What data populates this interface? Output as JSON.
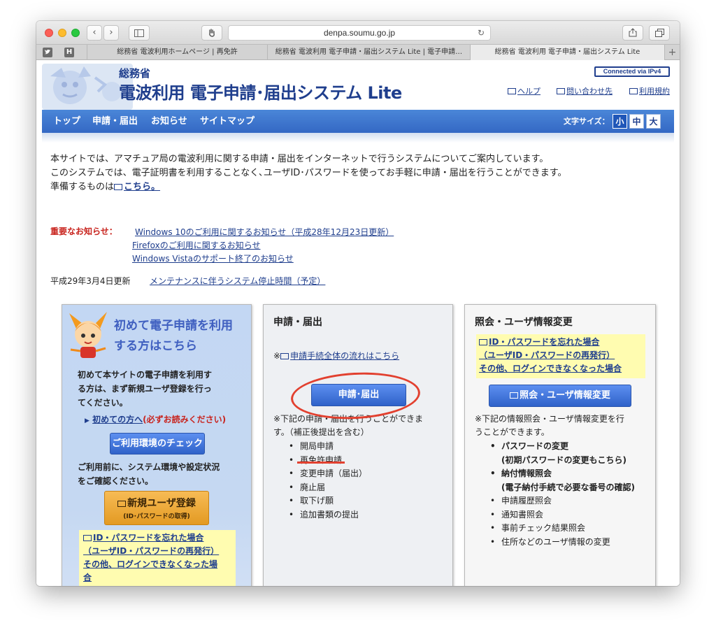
{
  "browser": {
    "url": "denpa.soumu.go.jp",
    "tabs": [
      {
        "label": "総務省 電波利用ホームページ | 再免許",
        "active": false
      },
      {
        "label": "総務省 電波利用 電子申請・届出システム Lite | 電子申請…",
        "active": false
      },
      {
        "label": "総務省 電波利用 電子申請・届出システム Lite",
        "active": true
      }
    ],
    "pinned": [
      "twitter-icon",
      "hatena-icon"
    ]
  },
  "header": {
    "org": "総務省",
    "title": "電波利用 電子申請･届出システム Lite",
    "badge": "Connected via IPv4",
    "links": [
      "ヘルプ",
      "問い合わせ先",
      "利用規約"
    ]
  },
  "nav": {
    "items": [
      "トップ",
      "申請・届出",
      "お知らせ",
      "サイトマップ"
    ],
    "font_size_label": "文字サイズ：",
    "font_sizes": [
      "小",
      "中",
      "大"
    ],
    "active_font_size": "小"
  },
  "intro": {
    "line1": "本サイトでは、アマチュア局の電波利用に関する申請・届出をインターネットで行うシステムについてご案内しています。",
    "line2": "このシステムでは、電子証明書を利用することなく､ユーザID･パスワードを使ってお手軽に申請・届出を行うことができます。",
    "line3_prefix": "準備するものは",
    "line3_link": "こちら。"
  },
  "notices": {
    "label": "重要なお知らせ：",
    "items": [
      "Windows 10のご利用に関するお知らせ（平成28年12月23日更新）",
      "Firefoxのご利用に関するお知らせ",
      "Windows Vistaのサポート終了のお知らせ"
    ]
  },
  "update": {
    "date": "平成29年3月4日更新",
    "link": "メンテナンスに伴うシステム停止時間（予定）"
  },
  "panel_first": {
    "title_line1": "初めて電子申請を利用",
    "title_line2": "する方はこちら",
    "desc": [
      "初めて本サイトの電子申請を利用す",
      "る方は、まず新規ユーザ登録を行っ",
      "てください。"
    ],
    "first_link": "初めての方へ",
    "first_link_note": "(必ずお読みください)",
    "env_button": "ご利用環境のチェック",
    "env_desc": [
      "ご利用前に、システム環境や設定状況",
      "をご確認ください。"
    ],
    "register_button": "新規ユーザ登録",
    "register_sub": "(ID･パスワードの取得)",
    "forgot": [
      "ID・パスワードを忘れた場合",
      "（ユーザID・パスワードの再発行）",
      "その他、ログインできなくなった場",
      "合"
    ]
  },
  "panel_apply": {
    "title": "申請・届出",
    "note_prefix": "※",
    "note_link": "申請手続全体の流れはこちら",
    "button": "申請･届出",
    "desc": [
      "※下記の申請・届出を行うことができま",
      "す。（補正後提出を含む）"
    ],
    "items": [
      "開局申請",
      "再免許申請",
      "変更申請（届出）",
      "廃止届",
      "取下げ願",
      "追加書類の提出"
    ]
  },
  "panel_inquiry": {
    "title": "照会・ユーザ情報変更",
    "forgot": [
      "ID・パスワードを忘れた場合",
      "（ユーザID・パスワードの再発行）",
      "その他、ログインできなくなった場合"
    ],
    "button": "照会・ユーザ情報変更",
    "desc": [
      "※下記の情報照会・ユーザ情報変更を行",
      "うことができます。"
    ],
    "items": [
      {
        "text": "パスワードの変更",
        "bold": true,
        "bullet": true
      },
      {
        "text": "(初期パスワードの変更もこちら)",
        "bold": true,
        "bullet": false
      },
      {
        "text": "納付情報照会",
        "bold": true,
        "bullet": true
      },
      {
        "text": "(電子納付手続で必要な番号の確認)",
        "bold": true,
        "bullet": false
      },
      {
        "text": "申請履歴照会",
        "bold": false,
        "bullet": true
      },
      {
        "text": "通知書照会",
        "bold": false,
        "bullet": true
      },
      {
        "text": "事前チェック結果照会",
        "bold": false,
        "bullet": true
      },
      {
        "text": "住所などのユーザ情報の変更",
        "bold": false,
        "bullet": true
      }
    ]
  },
  "colors": {
    "nav_blue": "#3a72cf",
    "brand_navy": "#1f3e8d",
    "notice_red": "#c8241e",
    "annotation_red": "#e2402f",
    "highlight_yellow": "#fffcb0",
    "orange_button": "#e9a431"
  }
}
